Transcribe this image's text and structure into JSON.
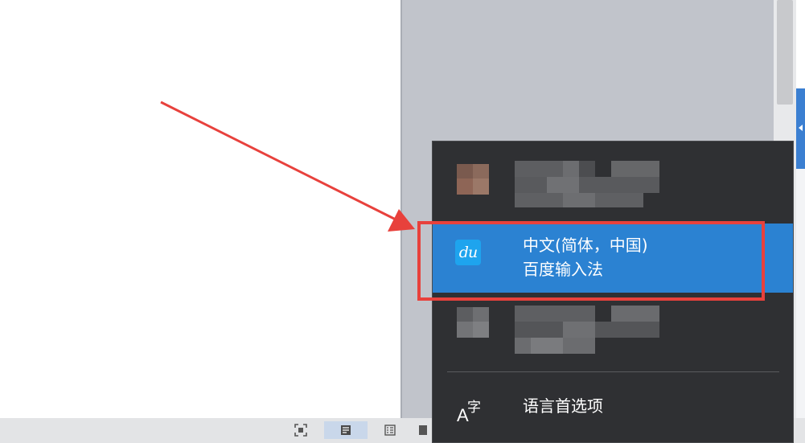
{
  "ime_menu": {
    "selected_item": {
      "language": "中文(简体，中国)",
      "keyboard": "百度输入法",
      "icon": "baidu-du-logo",
      "logo_text": "du"
    },
    "language_preferences": {
      "label": "语言首选项",
      "icon": "language-preferences-icon",
      "icon_glyph_a": "A",
      "icon_glyph_zi": "字"
    }
  },
  "colors": {
    "menu_bg": "#2f3033",
    "selected_bg": "#2b82d2",
    "annotation_red": "#e8413c",
    "workspace_gray": "#c1c4cb"
  }
}
